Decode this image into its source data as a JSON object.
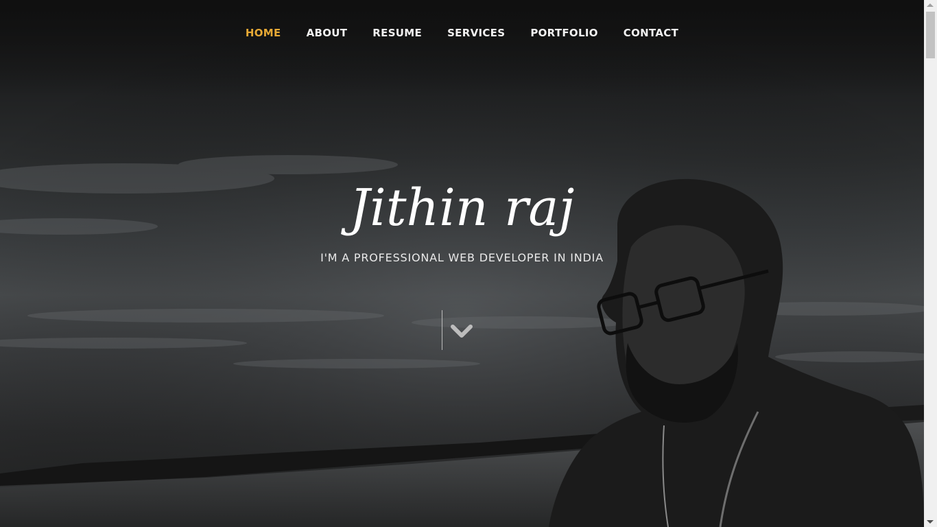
{
  "nav": {
    "items": [
      {
        "label": "HOME",
        "active": true
      },
      {
        "label": "ABOUT",
        "active": false
      },
      {
        "label": "RESUME",
        "active": false
      },
      {
        "label": "SERVICES",
        "active": false
      },
      {
        "label": "PORTFOLIO",
        "active": false
      },
      {
        "label": "CONTACT",
        "active": false
      }
    ],
    "active_color": "#e7a935",
    "text_color": "#f2f2f2"
  },
  "hero": {
    "title": "Jithin raj",
    "subtitle": "I'M A PROFESSIONAL WEB DEVELOPER IN INDIA",
    "scroll_icon": "chevron-down-icon"
  },
  "background": {
    "scene": "monochrome lakeside portrait"
  }
}
